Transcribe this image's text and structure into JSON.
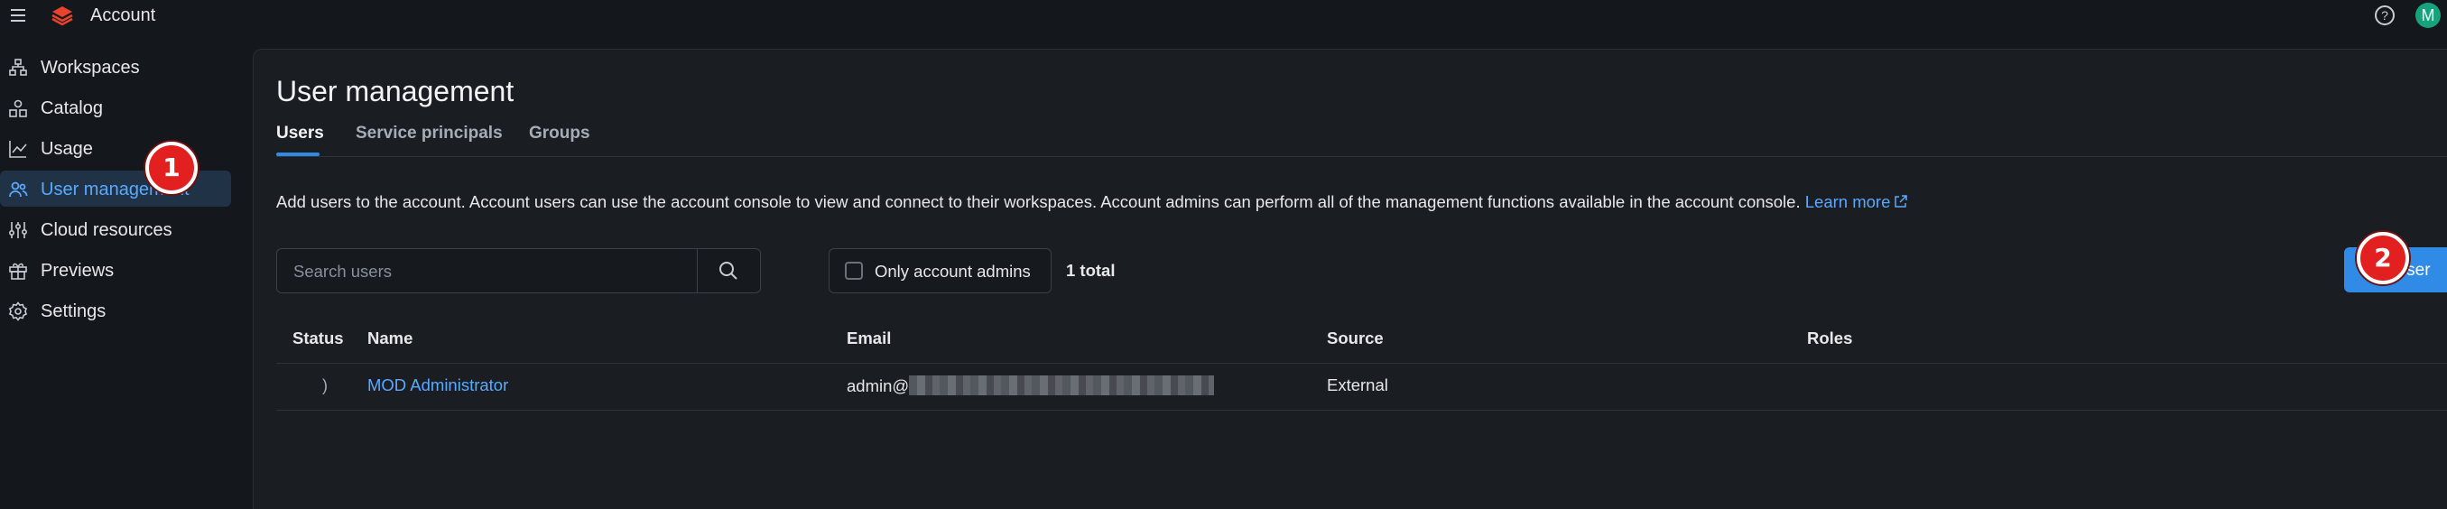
{
  "topbar": {
    "app_title": "Account",
    "avatar_initial": "M",
    "icons": [
      "menu-icon",
      "databricks-logo",
      "help-icon"
    ]
  },
  "sidebar": {
    "items": [
      {
        "label": "Workspaces",
        "icon": "workspaces-icon"
      },
      {
        "label": "Catalog",
        "icon": "catalog-icon"
      },
      {
        "label": "Usage",
        "icon": "usage-chart-icon"
      },
      {
        "label": "User management",
        "icon": "users-icon",
        "active": true
      },
      {
        "label": "Cloud resources",
        "icon": "sliders-icon"
      },
      {
        "label": "Previews",
        "icon": "gift-icon"
      },
      {
        "label": "Settings",
        "icon": "gear-icon"
      }
    ]
  },
  "main": {
    "title": "User management",
    "tabs": [
      {
        "label": "Users",
        "active": true
      },
      {
        "label": "Service principals"
      },
      {
        "label": "Groups"
      }
    ],
    "description": "Add users to the account. Account users can use the account console to view and connect to their workspaces. Account admins can perform all of the management functions available in the account console.",
    "learn_more": "Learn more",
    "search_placeholder": "Search users",
    "only_admins_label": "Only account admins",
    "total": "1 total",
    "add_user_label": "Add user"
  },
  "table": {
    "columns": [
      "Status",
      "Name",
      "Email",
      "Source",
      "Roles"
    ],
    "rows": [
      {
        "status": ")",
        "name": "MOD Administrator",
        "email_prefix": "admin@",
        "source": "External",
        "roles": ""
      }
    ]
  },
  "annotations": {
    "step1": "1",
    "step2": "2"
  },
  "colors": {
    "accent": "#2f8be6",
    "link": "#5aa9ff",
    "badge": "#e32020",
    "avatar": "#16a37b"
  }
}
